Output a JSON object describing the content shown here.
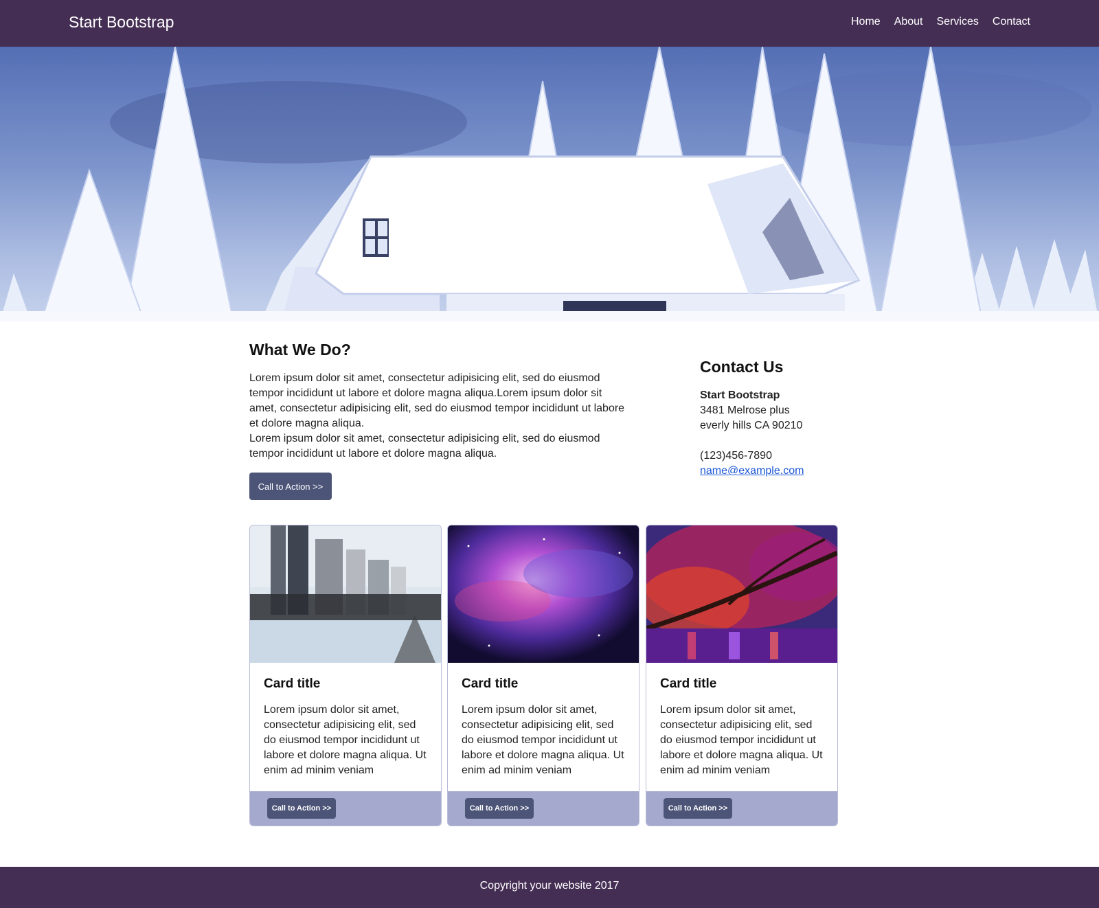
{
  "navbar": {
    "brand": "Start Bootstrap",
    "links": [
      "Home",
      "About",
      "Services",
      "Contact"
    ]
  },
  "hero": {
    "image": "snow-covered-house-with-pine-trees"
  },
  "about": {
    "heading": "What We Do?",
    "paragraph1": "Lorem ipsum dolor sit amet, consectetur adipisicing elit, sed do eiusmod tempor incididunt ut labore et dolore magna aliqua.Lorem ipsum dolor sit amet, consectetur adipisicing elit, sed do eiusmod tempor incididunt ut labore et dolore magna aliqua.",
    "paragraph2": "Lorem ipsum dolor sit amet, consectetur adipisicing elit, sed do eiusmod tempor incididunt ut labore et dolore magna aliqua.",
    "button": "Call to Action >>"
  },
  "contact": {
    "heading": "Contact Us",
    "company": "Start Bootstrap",
    "address1": "3481 Melrose plus",
    "address2": "everly hills CA 90210",
    "phone": "(123)456-7890",
    "email": "name@example.com"
  },
  "cards": [
    {
      "image": "winter-city-park",
      "title": "Card title",
      "text": "Lorem ipsum dolor sit amet, consectetur adipisicing elit, sed do eiusmod tempor incididunt ut labore et dolore magna aliqua. Ut enim ad minim veniam",
      "button": "Call to Action >>"
    },
    {
      "image": "purple-galaxy-nebula",
      "title": "Card title",
      "text": "Lorem ipsum dolor sit amet, consectetur adipisicing elit, sed do eiusmod tempor incididunt ut labore et dolore magna aliqua. Ut enim ad minim veniam",
      "button": "Call to Action >>"
    },
    {
      "image": "red-autumn-tree-over-water",
      "title": "Card title",
      "text": "Lorem ipsum dolor sit amet, consectetur adipisicing elit, sed do eiusmod tempor incididunt ut labore et dolore magna aliqua. Ut enim ad minim veniam",
      "button": "Call to Action >>"
    }
  ],
  "footer": {
    "text": "Copyright your website 2017"
  },
  "colors": {
    "navbar": "#452e54",
    "button": "#4c5578",
    "card_footer": "#a5a9ce",
    "link": "#1a56d6"
  }
}
